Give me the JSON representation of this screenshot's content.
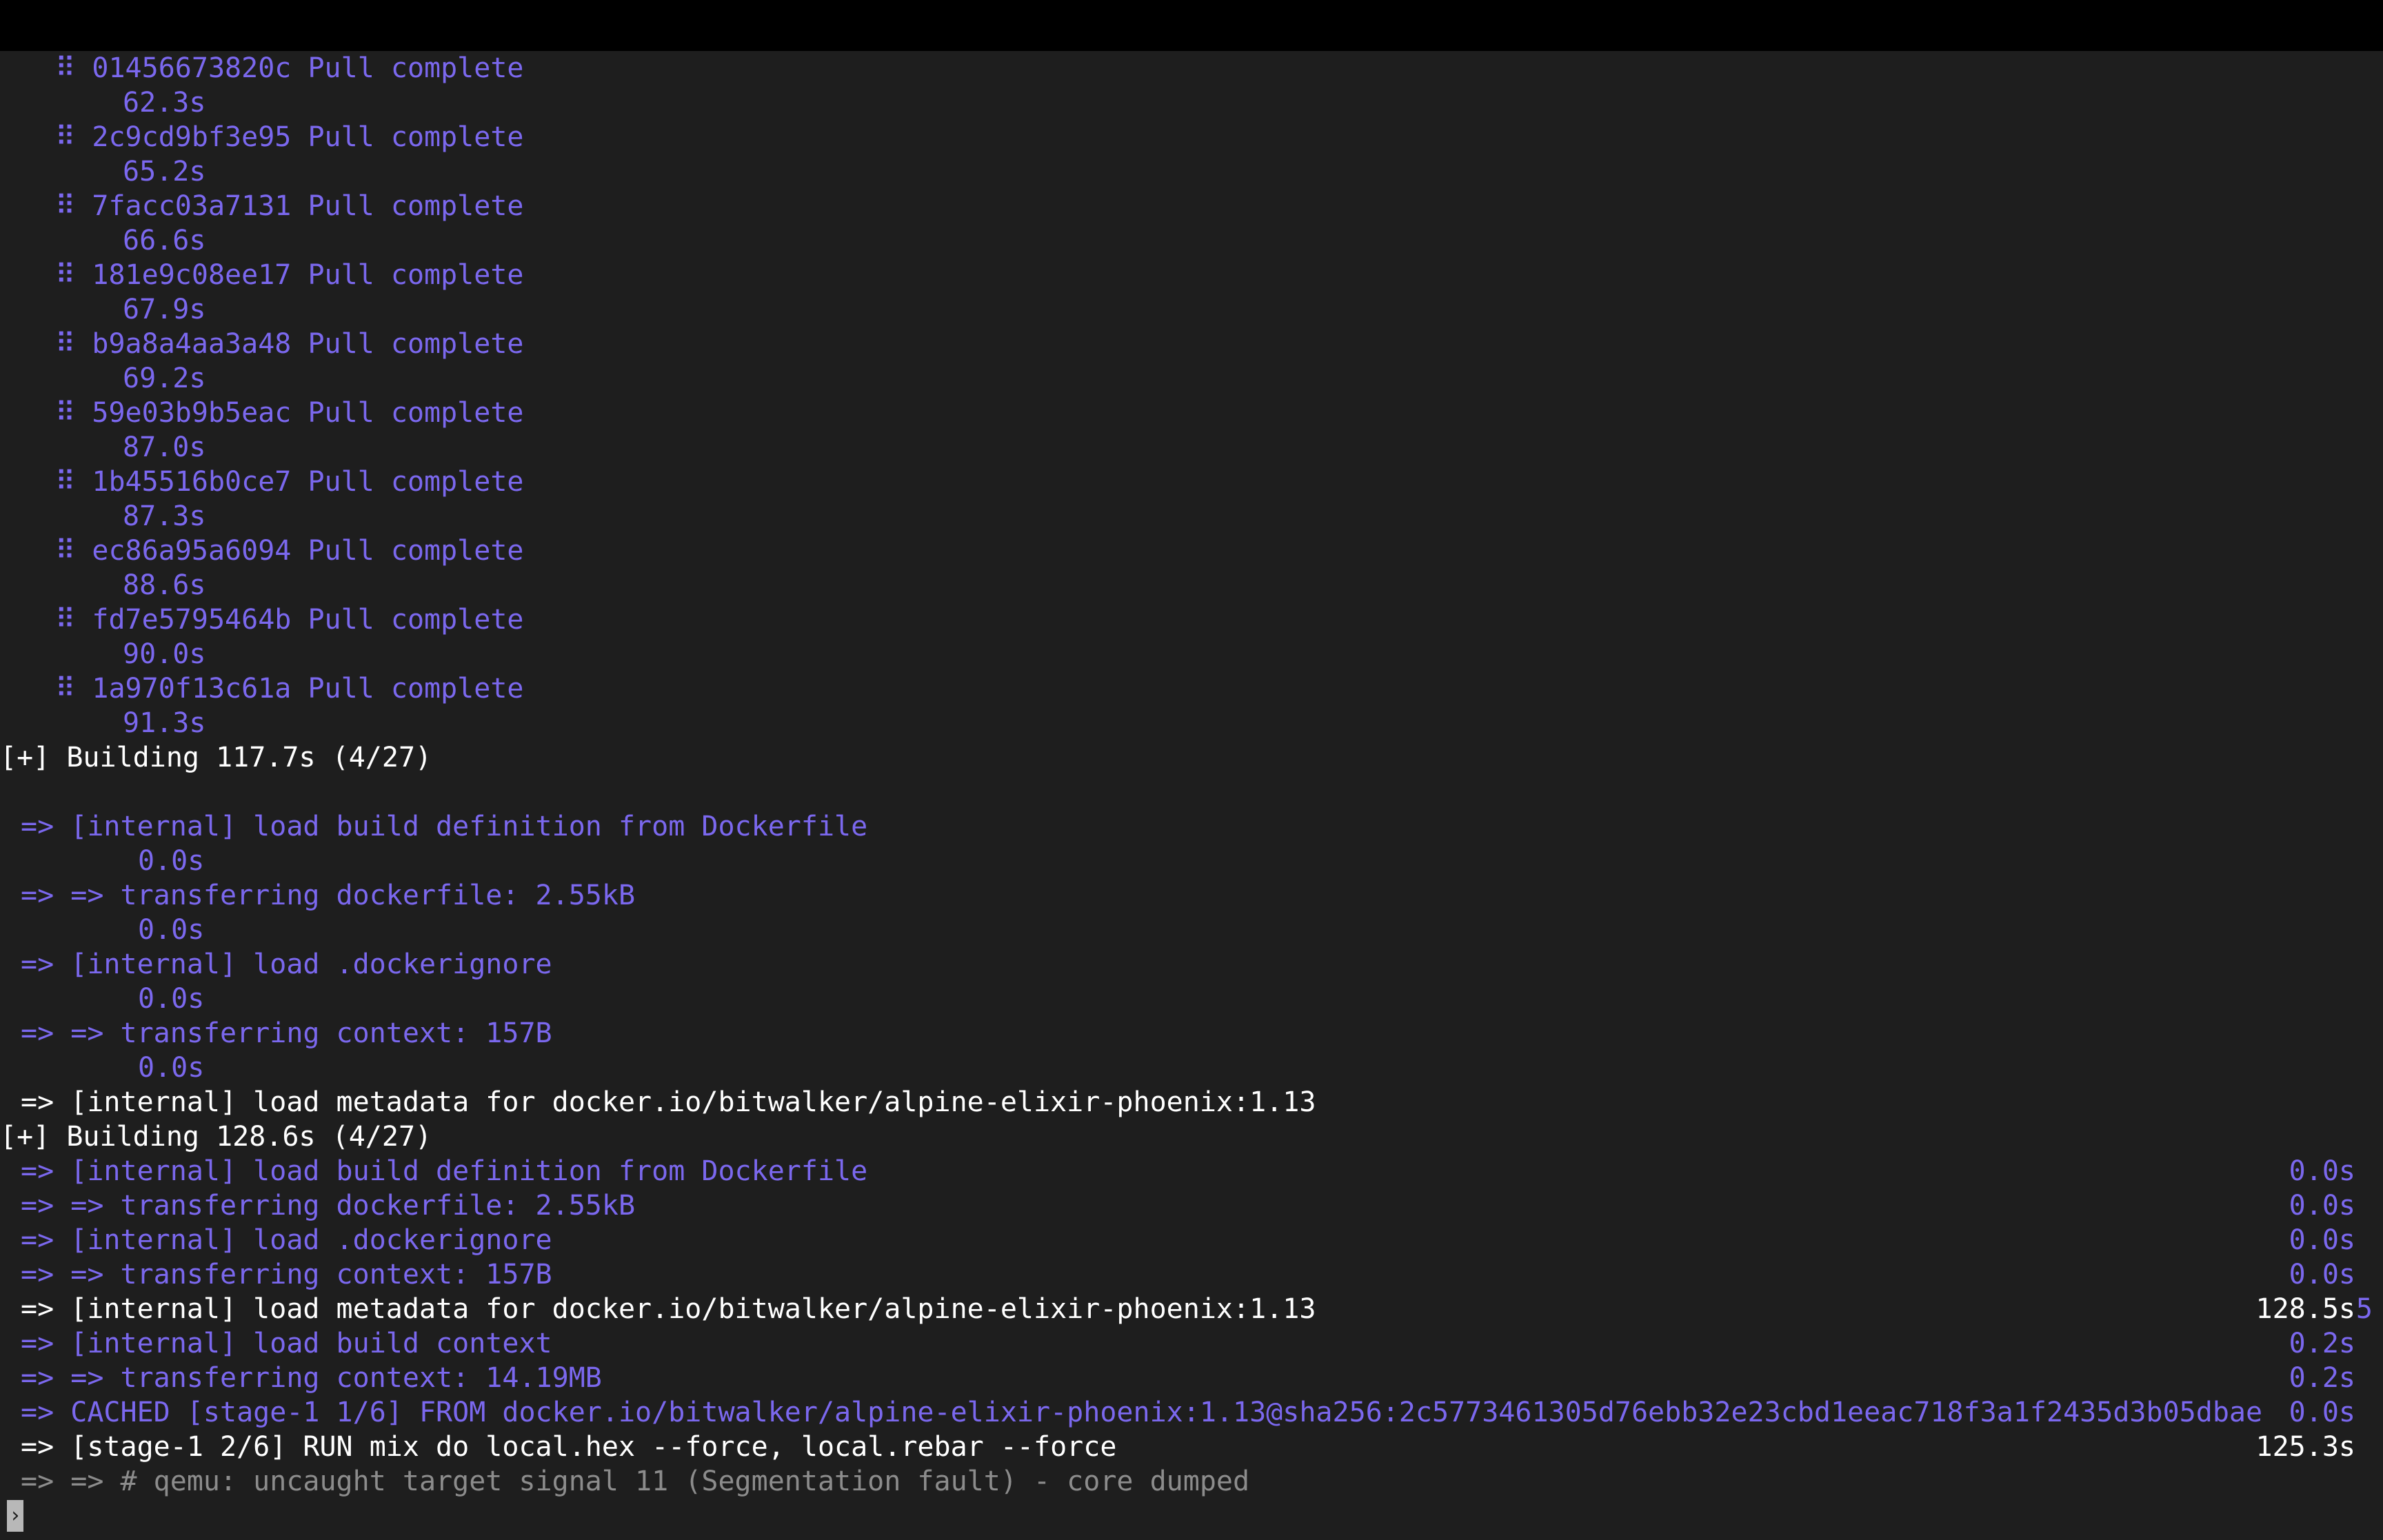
{
  "colors": {
    "background": "#1e1e1e",
    "titlebar": "#000000",
    "purple": "#7b68ee",
    "white": "#ffffff",
    "gray": "#8c8c8c"
  },
  "layers": [
    {
      "id": "01456673820c",
      "status": "Pull complete",
      "time": "62.3s"
    },
    {
      "id": "2c9cd9bf3e95",
      "status": "Pull complete",
      "time": "65.2s"
    },
    {
      "id": "7facc03a7131",
      "status": "Pull complete",
      "time": "66.6s"
    },
    {
      "id": "181e9c08ee17",
      "status": "Pull complete",
      "time": "67.9s"
    },
    {
      "id": "b9a8a4aa3a48",
      "status": "Pull complete",
      "time": "69.2s"
    },
    {
      "id": "59e03b9b5eac",
      "status": "Pull complete",
      "time": "87.0s"
    },
    {
      "id": "1b45516b0ce7",
      "status": "Pull complete",
      "time": "87.3s"
    },
    {
      "id": "ec86a95a6094",
      "status": "Pull complete",
      "time": "88.6s"
    },
    {
      "id": "fd7e5795464b",
      "status": "Pull complete",
      "time": "90.0s"
    },
    {
      "id": "1a970f13c61a",
      "status": "Pull complete",
      "time": "91.3s"
    }
  ],
  "layer_bullet": "⠿",
  "build1": {
    "header": "[+] Building 117.7s (4/27)",
    "steps": [
      {
        "text": "=> [internal] load build definition from Dockerfile",
        "time": "0.0s",
        "color": "purple"
      },
      {
        "text": "=> => transferring dockerfile: 2.55kB",
        "time": "0.0s",
        "color": "purple"
      },
      {
        "text": "=> [internal] load .dockerignore",
        "time": "0.0s",
        "color": "purple"
      },
      {
        "text": "=> => transferring context: 157B",
        "time": "0.0s",
        "color": "purple"
      },
      {
        "text": "=> [internal] load metadata for docker.io/bitwalker/alpine-elixir-phoenix:1.13",
        "time": "",
        "color": "white"
      }
    ]
  },
  "build2": {
    "header": "[+] Building 128.6s (4/27)",
    "steps": [
      {
        "text": "=> [internal] load build definition from Dockerfile",
        "time": "0.0s",
        "color": "purple",
        "tail": ""
      },
      {
        "text": "=> => transferring dockerfile: 2.55kB",
        "time": "0.0s",
        "color": "purple",
        "tail": ""
      },
      {
        "text": "=> [internal] load .dockerignore",
        "time": "0.0s",
        "color": "purple",
        "tail": ""
      },
      {
        "text": "=> => transferring context: 157B",
        "time": "0.0s",
        "color": "purple",
        "tail": ""
      },
      {
        "text": "=> [internal] load metadata for docker.io/bitwalker/alpine-elixir-phoenix:1.13",
        "time": "128.5s",
        "color": "white",
        "tail": "5"
      },
      {
        "text": "=> [internal] load build context",
        "time": "0.2s",
        "color": "purple",
        "tail": ""
      },
      {
        "text": "=> => transferring context: 14.19MB",
        "time": "0.2s",
        "color": "purple",
        "tail": ""
      },
      {
        "text": "=> CACHED [stage-1 1/6] FROM docker.io/bitwalker/alpine-elixir-phoenix:1.13@sha256:2c5773461305d76ebb32e23cbd1eeac718f3a1f2435d3b05dbae",
        "time": "0.0s",
        "color": "purple",
        "tail": ""
      },
      {
        "text": "=> [stage-1 2/6] RUN mix do local.hex --force, local.rebar --force",
        "time": "125.3s",
        "color": "white",
        "tail": ""
      },
      {
        "text": "=> => # qemu: uncaught target signal 11 (Segmentation fault) - core dumped",
        "time": "",
        "color": "gray",
        "tail": ""
      }
    ]
  },
  "prompt_glyph": "›"
}
